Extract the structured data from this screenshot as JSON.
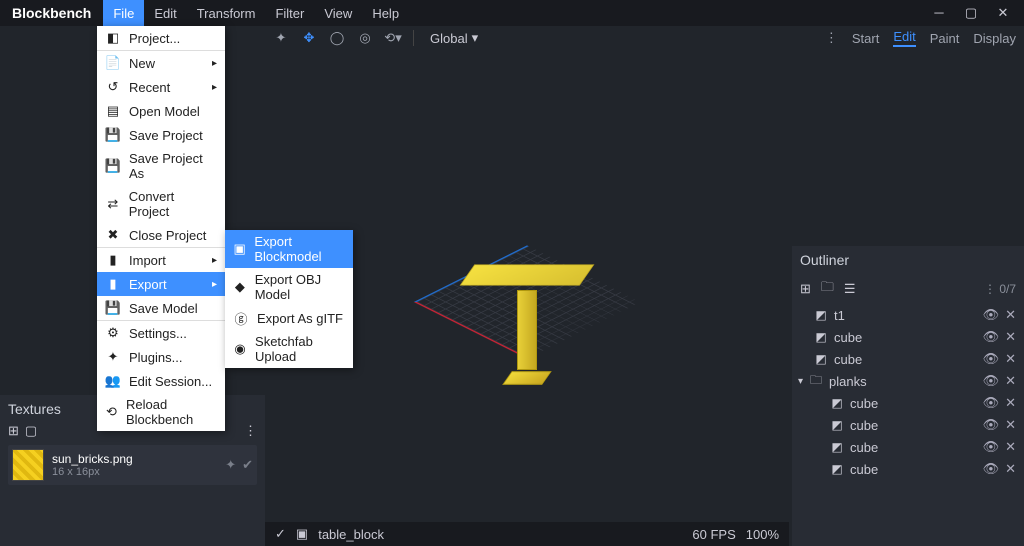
{
  "app": {
    "title": "Blockbench"
  },
  "menu": {
    "items": [
      "File",
      "Edit",
      "Transform",
      "Filter",
      "View",
      "Help"
    ],
    "active": 0
  },
  "file_menu": [
    {
      "icon": "◧",
      "label": "Project..."
    },
    {
      "icon": "📄",
      "label": "New",
      "arrow": true,
      "sep": true
    },
    {
      "icon": "↺",
      "label": "Recent",
      "arrow": true
    },
    {
      "icon": "▤",
      "label": "Open Model"
    },
    {
      "icon": "💾",
      "label": "Save Project"
    },
    {
      "icon": "💾",
      "label": "Save Project As"
    },
    {
      "icon": "⇄",
      "label": "Convert Project"
    },
    {
      "icon": "✖",
      "label": "Close Project"
    },
    {
      "icon": "▮",
      "label": "Import",
      "arrow": true,
      "sep": true
    },
    {
      "icon": "▮",
      "label": "Export",
      "arrow": true,
      "highlight": true
    },
    {
      "icon": "💾",
      "label": "Save Model"
    },
    {
      "icon": "⚙",
      "label": "Settings...",
      "sep": true
    },
    {
      "icon": "✦",
      "label": "Plugins..."
    },
    {
      "icon": "👥",
      "label": "Edit Session..."
    },
    {
      "icon": "⟲",
      "label": "Reload Blockbench"
    }
  ],
  "export_submenu": [
    {
      "icon": "▣",
      "label": "Export Blockmodel",
      "highlight": true
    },
    {
      "icon": "◆",
      "label": "Export OBJ Model"
    },
    {
      "icon": "ⓖ",
      "label": "Export As gITF"
    },
    {
      "icon": "◉",
      "label": "Sketchfab Upload"
    }
  ],
  "toolbar": {
    "global": "Global"
  },
  "modes": {
    "items": [
      "Start",
      "Edit",
      "Paint",
      "Display"
    ],
    "active": 1
  },
  "textures": {
    "title": "Textures",
    "item": {
      "name": "sun_bricks.png",
      "dim": "16 x 16px"
    }
  },
  "outliner": {
    "title": "Outliner",
    "count": "0/7",
    "rows": [
      {
        "indent": 1,
        "icon": "◩",
        "label": "t1"
      },
      {
        "indent": 1,
        "icon": "◩",
        "label": "cube"
      },
      {
        "indent": 1,
        "icon": "◩",
        "label": "cube"
      },
      {
        "indent": 0,
        "icon": "🗀",
        "label": "planks",
        "caret": true
      },
      {
        "indent": 2,
        "icon": "◩",
        "label": "cube"
      },
      {
        "indent": 2,
        "icon": "◩",
        "label": "cube"
      },
      {
        "indent": 2,
        "icon": "◩",
        "label": "cube"
      },
      {
        "indent": 2,
        "icon": "◩",
        "label": "cube"
      }
    ]
  },
  "status": {
    "name": "table_block",
    "fps": "60 FPS",
    "zoom": "100%"
  }
}
